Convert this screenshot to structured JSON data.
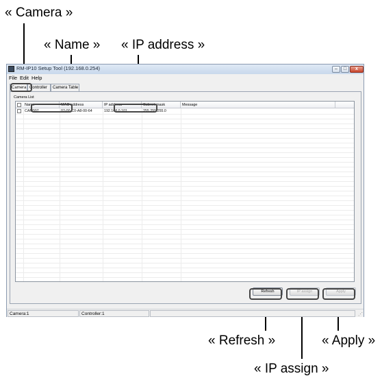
{
  "callouts": {
    "camera": "« Camera »",
    "name": "« Name »",
    "ip_address": "« IP address »",
    "refresh": "« Refresh »",
    "apply": "« Apply »",
    "ip_assign": "« IP assign »"
  },
  "window": {
    "title": "RM-IP10 Setup Tool (192.168.0.254)",
    "controls": {
      "minimize": "–",
      "maximize": "□",
      "close": "x"
    }
  },
  "menu": {
    "file": "File",
    "edit": "Edit",
    "help": "Help"
  },
  "tabs": [
    "Camera",
    "Controller",
    "Camera Table"
  ],
  "group_label": "Camera List",
  "table": {
    "columns": [
      "Name",
      "MAC address",
      "IP address",
      "Subnet mask",
      "Message"
    ],
    "rows": [
      {
        "checked": false,
        "name": "CAM007",
        "mac": "02-00-C0-A8-00-64",
        "ip": "192.168.0.101",
        "subnet": "255.255.255.0",
        "message": ""
      }
    ]
  },
  "buttons": {
    "refresh": "Refresh",
    "ip_assign": "IP assign",
    "apply": "Apply"
  },
  "status": {
    "camera": "Camera:1",
    "controller": "Controller:1"
  }
}
